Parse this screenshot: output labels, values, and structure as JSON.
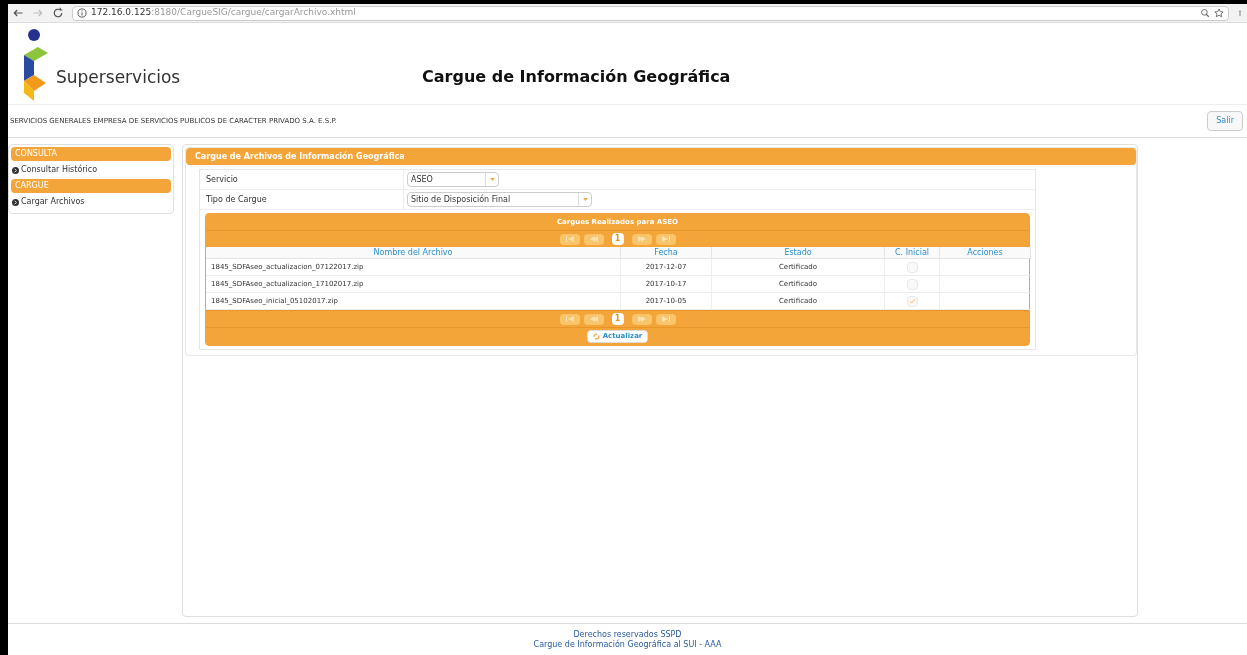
{
  "browser": {
    "url_host": "172.16.0.125",
    "url_rest": ":8180/CargueSIG/cargue/cargarArchivo.xhtml"
  },
  "header": {
    "logo_text": "Superservicios",
    "title": "Cargue de Información Geográfica"
  },
  "company": "SERVICIOS GENERALES EMPRESA DE SERVICIOS PUBLICOS DE CARACTER PRIVADO S.A. E.S.P.",
  "logout_button": "Salir",
  "sidebar": [
    {
      "heading": "CONSULTA",
      "items": [
        "Consultar Histórico"
      ]
    },
    {
      "heading": "CARGUE",
      "items": [
        "Cargar Archivos"
      ]
    }
  ],
  "panel": {
    "title": "Cargue de Archivos de Información Geográfica",
    "fields": [
      {
        "label": "Servicio",
        "value": "ASEO"
      },
      {
        "label": "Tipo de Cargue",
        "value": "Sitio de Disposición Final"
      }
    ],
    "table": {
      "caption": "Cargues Realizados para ASEO",
      "pages_top": [
        {
          "label": "1",
          "selected": true
        }
      ],
      "pages_bottom": [
        {
          "label": "1",
          "selected": true
        }
      ],
      "columns": [
        "Nombre del Archivo",
        "Fecha",
        "Estado",
        "C. Inicial",
        "Acciones"
      ],
      "rows": [
        {
          "file": "1845_SDFAseo_actualizacion_07122017.zip",
          "date": "2017-12-07",
          "status": "Certificado",
          "checked": false
        },
        {
          "file": "1845_SDFAseo_actualizacion_17102017.zip",
          "date": "2017-10-17",
          "status": "Certificado",
          "checked": false
        },
        {
          "file": "1845_SDFAseo_inicial_05102017.zip",
          "date": "2017-10-05",
          "status": "Certificado",
          "checked": true
        }
      ],
      "refresh_button": "Actualizar"
    }
  },
  "footer": [
    "Derechos reservados SSPD",
    "Cargue de Información Geográfica al SUI - AAA"
  ]
}
